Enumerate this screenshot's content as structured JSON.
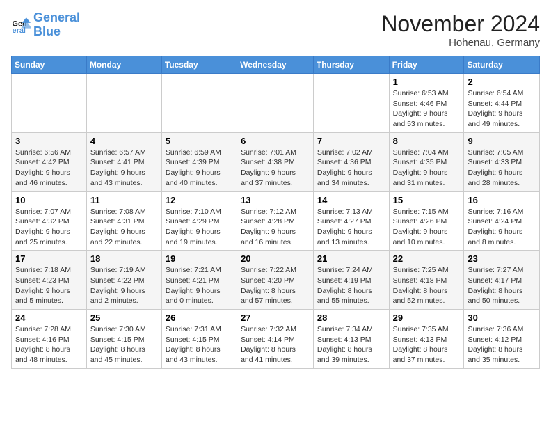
{
  "logo": {
    "line1": "General",
    "line2": "Blue"
  },
  "title": "November 2024",
  "location": "Hohenau, Germany",
  "headers": [
    "Sunday",
    "Monday",
    "Tuesday",
    "Wednesday",
    "Thursday",
    "Friday",
    "Saturday"
  ],
  "weeks": [
    [
      {
        "day": "",
        "info": ""
      },
      {
        "day": "",
        "info": ""
      },
      {
        "day": "",
        "info": ""
      },
      {
        "day": "",
        "info": ""
      },
      {
        "day": "",
        "info": ""
      },
      {
        "day": "1",
        "info": "Sunrise: 6:53 AM\nSunset: 4:46 PM\nDaylight: 9 hours\nand 53 minutes."
      },
      {
        "day": "2",
        "info": "Sunrise: 6:54 AM\nSunset: 4:44 PM\nDaylight: 9 hours\nand 49 minutes."
      }
    ],
    [
      {
        "day": "3",
        "info": "Sunrise: 6:56 AM\nSunset: 4:42 PM\nDaylight: 9 hours\nand 46 minutes."
      },
      {
        "day": "4",
        "info": "Sunrise: 6:57 AM\nSunset: 4:41 PM\nDaylight: 9 hours\nand 43 minutes."
      },
      {
        "day": "5",
        "info": "Sunrise: 6:59 AM\nSunset: 4:39 PM\nDaylight: 9 hours\nand 40 minutes."
      },
      {
        "day": "6",
        "info": "Sunrise: 7:01 AM\nSunset: 4:38 PM\nDaylight: 9 hours\nand 37 minutes."
      },
      {
        "day": "7",
        "info": "Sunrise: 7:02 AM\nSunset: 4:36 PM\nDaylight: 9 hours\nand 34 minutes."
      },
      {
        "day": "8",
        "info": "Sunrise: 7:04 AM\nSunset: 4:35 PM\nDaylight: 9 hours\nand 31 minutes."
      },
      {
        "day": "9",
        "info": "Sunrise: 7:05 AM\nSunset: 4:33 PM\nDaylight: 9 hours\nand 28 minutes."
      }
    ],
    [
      {
        "day": "10",
        "info": "Sunrise: 7:07 AM\nSunset: 4:32 PM\nDaylight: 9 hours\nand 25 minutes."
      },
      {
        "day": "11",
        "info": "Sunrise: 7:08 AM\nSunset: 4:31 PM\nDaylight: 9 hours\nand 22 minutes."
      },
      {
        "day": "12",
        "info": "Sunrise: 7:10 AM\nSunset: 4:29 PM\nDaylight: 9 hours\nand 19 minutes."
      },
      {
        "day": "13",
        "info": "Sunrise: 7:12 AM\nSunset: 4:28 PM\nDaylight: 9 hours\nand 16 minutes."
      },
      {
        "day": "14",
        "info": "Sunrise: 7:13 AM\nSunset: 4:27 PM\nDaylight: 9 hours\nand 13 minutes."
      },
      {
        "day": "15",
        "info": "Sunrise: 7:15 AM\nSunset: 4:26 PM\nDaylight: 9 hours\nand 10 minutes."
      },
      {
        "day": "16",
        "info": "Sunrise: 7:16 AM\nSunset: 4:24 PM\nDaylight: 9 hours\nand 8 minutes."
      }
    ],
    [
      {
        "day": "17",
        "info": "Sunrise: 7:18 AM\nSunset: 4:23 PM\nDaylight: 9 hours\nand 5 minutes."
      },
      {
        "day": "18",
        "info": "Sunrise: 7:19 AM\nSunset: 4:22 PM\nDaylight: 9 hours\nand 2 minutes."
      },
      {
        "day": "19",
        "info": "Sunrise: 7:21 AM\nSunset: 4:21 PM\nDaylight: 9 hours\nand 0 minutes."
      },
      {
        "day": "20",
        "info": "Sunrise: 7:22 AM\nSunset: 4:20 PM\nDaylight: 8 hours\nand 57 minutes."
      },
      {
        "day": "21",
        "info": "Sunrise: 7:24 AM\nSunset: 4:19 PM\nDaylight: 8 hours\nand 55 minutes."
      },
      {
        "day": "22",
        "info": "Sunrise: 7:25 AM\nSunset: 4:18 PM\nDaylight: 8 hours\nand 52 minutes."
      },
      {
        "day": "23",
        "info": "Sunrise: 7:27 AM\nSunset: 4:17 PM\nDaylight: 8 hours\nand 50 minutes."
      }
    ],
    [
      {
        "day": "24",
        "info": "Sunrise: 7:28 AM\nSunset: 4:16 PM\nDaylight: 8 hours\nand 48 minutes."
      },
      {
        "day": "25",
        "info": "Sunrise: 7:30 AM\nSunset: 4:15 PM\nDaylight: 8 hours\nand 45 minutes."
      },
      {
        "day": "26",
        "info": "Sunrise: 7:31 AM\nSunset: 4:15 PM\nDaylight: 8 hours\nand 43 minutes."
      },
      {
        "day": "27",
        "info": "Sunrise: 7:32 AM\nSunset: 4:14 PM\nDaylight: 8 hours\nand 41 minutes."
      },
      {
        "day": "28",
        "info": "Sunrise: 7:34 AM\nSunset: 4:13 PM\nDaylight: 8 hours\nand 39 minutes."
      },
      {
        "day": "29",
        "info": "Sunrise: 7:35 AM\nSunset: 4:13 PM\nDaylight: 8 hours\nand 37 minutes."
      },
      {
        "day": "30",
        "info": "Sunrise: 7:36 AM\nSunset: 4:12 PM\nDaylight: 8 hours\nand 35 minutes."
      }
    ]
  ]
}
